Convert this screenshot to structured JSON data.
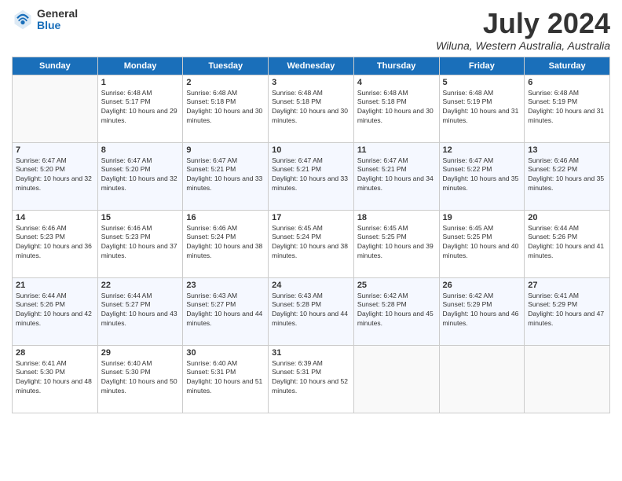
{
  "logo": {
    "general": "General",
    "blue": "Blue"
  },
  "title": "July 2024",
  "location": "Wiluna, Western Australia, Australia",
  "weekdays": [
    "Sunday",
    "Monday",
    "Tuesday",
    "Wednesday",
    "Thursday",
    "Friday",
    "Saturday"
  ],
  "weeks": [
    [
      {
        "day": "",
        "sunrise": "",
        "sunset": "",
        "daylight": ""
      },
      {
        "day": "1",
        "sunrise": "Sunrise: 6:48 AM",
        "sunset": "Sunset: 5:17 PM",
        "daylight": "Daylight: 10 hours and 29 minutes."
      },
      {
        "day": "2",
        "sunrise": "Sunrise: 6:48 AM",
        "sunset": "Sunset: 5:18 PM",
        "daylight": "Daylight: 10 hours and 30 minutes."
      },
      {
        "day": "3",
        "sunrise": "Sunrise: 6:48 AM",
        "sunset": "Sunset: 5:18 PM",
        "daylight": "Daylight: 10 hours and 30 minutes."
      },
      {
        "day": "4",
        "sunrise": "Sunrise: 6:48 AM",
        "sunset": "Sunset: 5:18 PM",
        "daylight": "Daylight: 10 hours and 30 minutes."
      },
      {
        "day": "5",
        "sunrise": "Sunrise: 6:48 AM",
        "sunset": "Sunset: 5:19 PM",
        "daylight": "Daylight: 10 hours and 31 minutes."
      },
      {
        "day": "6",
        "sunrise": "Sunrise: 6:48 AM",
        "sunset": "Sunset: 5:19 PM",
        "daylight": "Daylight: 10 hours and 31 minutes."
      }
    ],
    [
      {
        "day": "7",
        "sunrise": "Sunrise: 6:47 AM",
        "sunset": "Sunset: 5:20 PM",
        "daylight": "Daylight: 10 hours and 32 minutes."
      },
      {
        "day": "8",
        "sunrise": "Sunrise: 6:47 AM",
        "sunset": "Sunset: 5:20 PM",
        "daylight": "Daylight: 10 hours and 32 minutes."
      },
      {
        "day": "9",
        "sunrise": "Sunrise: 6:47 AM",
        "sunset": "Sunset: 5:21 PM",
        "daylight": "Daylight: 10 hours and 33 minutes."
      },
      {
        "day": "10",
        "sunrise": "Sunrise: 6:47 AM",
        "sunset": "Sunset: 5:21 PM",
        "daylight": "Daylight: 10 hours and 33 minutes."
      },
      {
        "day": "11",
        "sunrise": "Sunrise: 6:47 AM",
        "sunset": "Sunset: 5:21 PM",
        "daylight": "Daylight: 10 hours and 34 minutes."
      },
      {
        "day": "12",
        "sunrise": "Sunrise: 6:47 AM",
        "sunset": "Sunset: 5:22 PM",
        "daylight": "Daylight: 10 hours and 35 minutes."
      },
      {
        "day": "13",
        "sunrise": "Sunrise: 6:46 AM",
        "sunset": "Sunset: 5:22 PM",
        "daylight": "Daylight: 10 hours and 35 minutes."
      }
    ],
    [
      {
        "day": "14",
        "sunrise": "Sunrise: 6:46 AM",
        "sunset": "Sunset: 5:23 PM",
        "daylight": "Daylight: 10 hours and 36 minutes."
      },
      {
        "day": "15",
        "sunrise": "Sunrise: 6:46 AM",
        "sunset": "Sunset: 5:23 PM",
        "daylight": "Daylight: 10 hours and 37 minutes."
      },
      {
        "day": "16",
        "sunrise": "Sunrise: 6:46 AM",
        "sunset": "Sunset: 5:24 PM",
        "daylight": "Daylight: 10 hours and 38 minutes."
      },
      {
        "day": "17",
        "sunrise": "Sunrise: 6:45 AM",
        "sunset": "Sunset: 5:24 PM",
        "daylight": "Daylight: 10 hours and 38 minutes."
      },
      {
        "day": "18",
        "sunrise": "Sunrise: 6:45 AM",
        "sunset": "Sunset: 5:25 PM",
        "daylight": "Daylight: 10 hours and 39 minutes."
      },
      {
        "day": "19",
        "sunrise": "Sunrise: 6:45 AM",
        "sunset": "Sunset: 5:25 PM",
        "daylight": "Daylight: 10 hours and 40 minutes."
      },
      {
        "day": "20",
        "sunrise": "Sunrise: 6:44 AM",
        "sunset": "Sunset: 5:26 PM",
        "daylight": "Daylight: 10 hours and 41 minutes."
      }
    ],
    [
      {
        "day": "21",
        "sunrise": "Sunrise: 6:44 AM",
        "sunset": "Sunset: 5:26 PM",
        "daylight": "Daylight: 10 hours and 42 minutes."
      },
      {
        "day": "22",
        "sunrise": "Sunrise: 6:44 AM",
        "sunset": "Sunset: 5:27 PM",
        "daylight": "Daylight: 10 hours and 43 minutes."
      },
      {
        "day": "23",
        "sunrise": "Sunrise: 6:43 AM",
        "sunset": "Sunset: 5:27 PM",
        "daylight": "Daylight: 10 hours and 44 minutes."
      },
      {
        "day": "24",
        "sunrise": "Sunrise: 6:43 AM",
        "sunset": "Sunset: 5:28 PM",
        "daylight": "Daylight: 10 hours and 44 minutes."
      },
      {
        "day": "25",
        "sunrise": "Sunrise: 6:42 AM",
        "sunset": "Sunset: 5:28 PM",
        "daylight": "Daylight: 10 hours and 45 minutes."
      },
      {
        "day": "26",
        "sunrise": "Sunrise: 6:42 AM",
        "sunset": "Sunset: 5:29 PM",
        "daylight": "Daylight: 10 hours and 46 minutes."
      },
      {
        "day": "27",
        "sunrise": "Sunrise: 6:41 AM",
        "sunset": "Sunset: 5:29 PM",
        "daylight": "Daylight: 10 hours and 47 minutes."
      }
    ],
    [
      {
        "day": "28",
        "sunrise": "Sunrise: 6:41 AM",
        "sunset": "Sunset: 5:30 PM",
        "daylight": "Daylight: 10 hours and 48 minutes."
      },
      {
        "day": "29",
        "sunrise": "Sunrise: 6:40 AM",
        "sunset": "Sunset: 5:30 PM",
        "daylight": "Daylight: 10 hours and 50 minutes."
      },
      {
        "day": "30",
        "sunrise": "Sunrise: 6:40 AM",
        "sunset": "Sunset: 5:31 PM",
        "daylight": "Daylight: 10 hours and 51 minutes."
      },
      {
        "day": "31",
        "sunrise": "Sunrise: 6:39 AM",
        "sunset": "Sunset: 5:31 PM",
        "daylight": "Daylight: 10 hours and 52 minutes."
      },
      {
        "day": "",
        "sunrise": "",
        "sunset": "",
        "daylight": ""
      },
      {
        "day": "",
        "sunrise": "",
        "sunset": "",
        "daylight": ""
      },
      {
        "day": "",
        "sunrise": "",
        "sunset": "",
        "daylight": ""
      }
    ]
  ]
}
